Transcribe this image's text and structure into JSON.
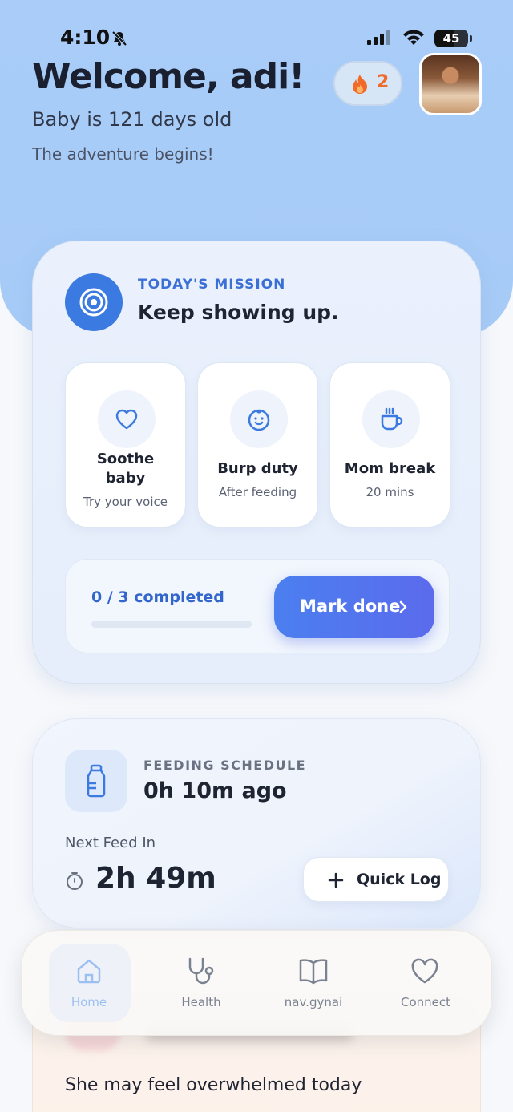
{
  "status_bar": {
    "time": "4:10",
    "battery": "45"
  },
  "header": {
    "welcome": "Welcome, adi!",
    "baby_age": "Baby is 121 days old",
    "tagline": "The adventure begins!",
    "streak_count": "2"
  },
  "mission": {
    "label": "TODAY'S MISSION",
    "title": "Keep showing up.",
    "tasks": [
      {
        "title_line1": "Soothe",
        "title_line2": "baby",
        "subtitle": "Try your voice",
        "icon": "heart-icon"
      },
      {
        "title": "Burp duty",
        "subtitle": "After feeding",
        "icon": "baby-face-icon"
      },
      {
        "title": "Mom break",
        "subtitle": "20 mins",
        "icon": "coffee-cup-icon"
      }
    ],
    "progress_text": "0 / 3 completed",
    "progress_fraction": 0,
    "mark_done_label": "Mark done"
  },
  "feeding": {
    "label": "FEEDING SCHEDULE",
    "last_feed": "0h 10m ago",
    "next_label": "Next Feed In",
    "next_time": "2h 49m",
    "quick_log_label": "Quick Log"
  },
  "insight": {
    "text": "She may feel overwhelmed today"
  },
  "nav": {
    "items": [
      {
        "label": "Home",
        "icon": "home-icon",
        "active": true
      },
      {
        "label": "Health",
        "icon": "stethoscope-icon"
      },
      {
        "label": "nav.gynai",
        "icon": "book-icon"
      },
      {
        "label": "Connect",
        "icon": "heart-icon"
      }
    ]
  },
  "colors": {
    "accent": "#3b7ae0",
    "hero_bg": "#a9cdf8",
    "streak_flame": "#f06a2a"
  }
}
